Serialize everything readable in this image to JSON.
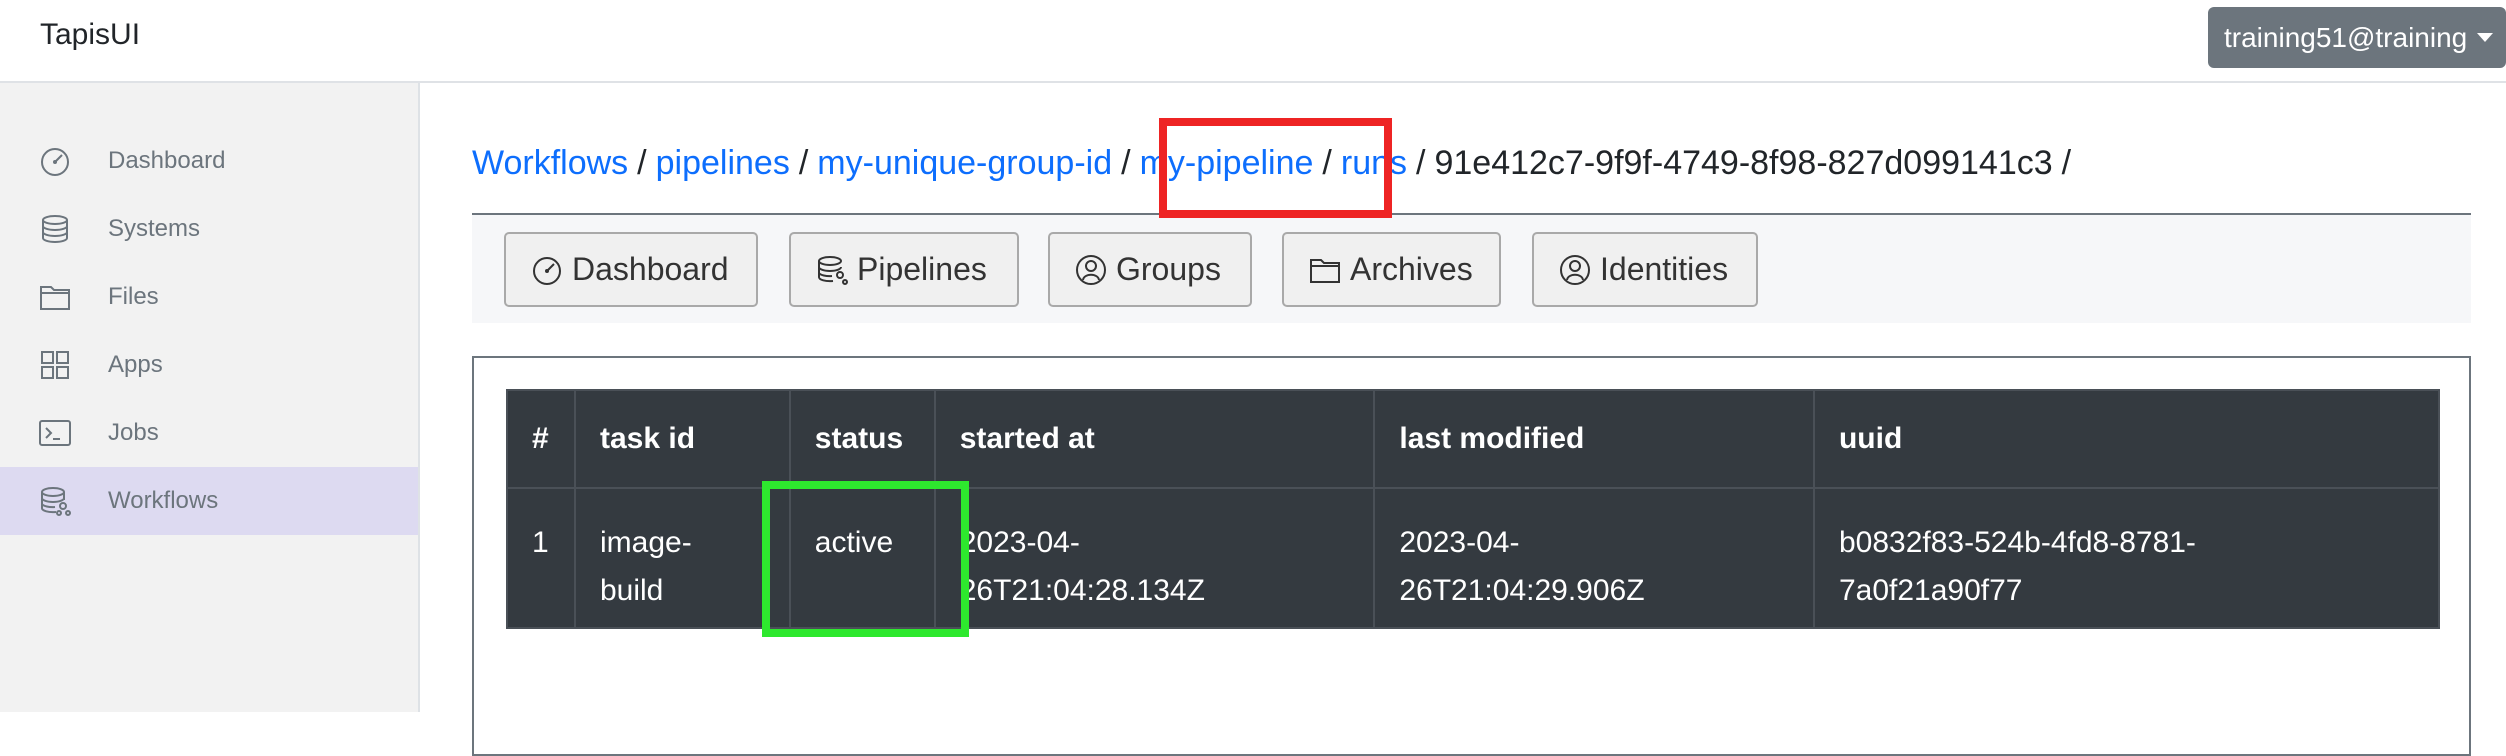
{
  "app": {
    "brand": "TapisUI"
  },
  "user_menu": {
    "label": "training51@training"
  },
  "sidebar": {
    "items": [
      {
        "label": "Dashboard",
        "icon": "dashboard-gauge-icon"
      },
      {
        "label": "Systems",
        "icon": "database-icon"
      },
      {
        "label": "Files",
        "icon": "folder-icon"
      },
      {
        "label": "Apps",
        "icon": "grid-icon"
      },
      {
        "label": "Jobs",
        "icon": "terminal-icon"
      },
      {
        "label": "Workflows",
        "icon": "workflow-database-icon",
        "active": true
      }
    ]
  },
  "breadcrumb": {
    "items": [
      {
        "label": "Workflows",
        "link": true
      },
      {
        "label": "pipelines",
        "link": true
      },
      {
        "label": "my-unique-group-id",
        "link": true
      },
      {
        "label": "my-pipeline",
        "link": true
      },
      {
        "label": "runs",
        "link": true
      },
      {
        "label": "91e412c7-9f9f-4749-8f98-827d099141c3",
        "link": false
      }
    ],
    "separator": "/"
  },
  "toolbar": {
    "buttons": [
      {
        "label": "Dashboard",
        "icon": "dashboard-gauge-icon"
      },
      {
        "label": "Pipelines",
        "icon": "pipelines-icon"
      },
      {
        "label": "Groups",
        "icon": "user-circle-icon"
      },
      {
        "label": "Archives",
        "icon": "folder-icon"
      },
      {
        "label": "Identities",
        "icon": "user-circle-icon"
      }
    ]
  },
  "runs_table": {
    "columns": [
      "#",
      "task id",
      "status",
      "started at",
      "last modified",
      "uuid"
    ],
    "rows": [
      {
        "index": "1",
        "task_id_lines": [
          "image-",
          "build"
        ],
        "status": "active",
        "started_at_lines": [
          "2023-04-",
          "26T21:04:28.134Z"
        ],
        "last_modified_lines": [
          "2023-04-",
          "26T21:04:29.906Z"
        ],
        "uuid_lines": [
          "b0832f83-524b-4fd8-8781-",
          "7a0f21a90f77"
        ]
      }
    ]
  },
  "highlights": {
    "red": "#ee2424",
    "green": "#2ee82e"
  },
  "colors": {
    "accent_link": "#0d6efd",
    "sidebar_active": "#dddaf1",
    "table_bg": "#343a40"
  }
}
